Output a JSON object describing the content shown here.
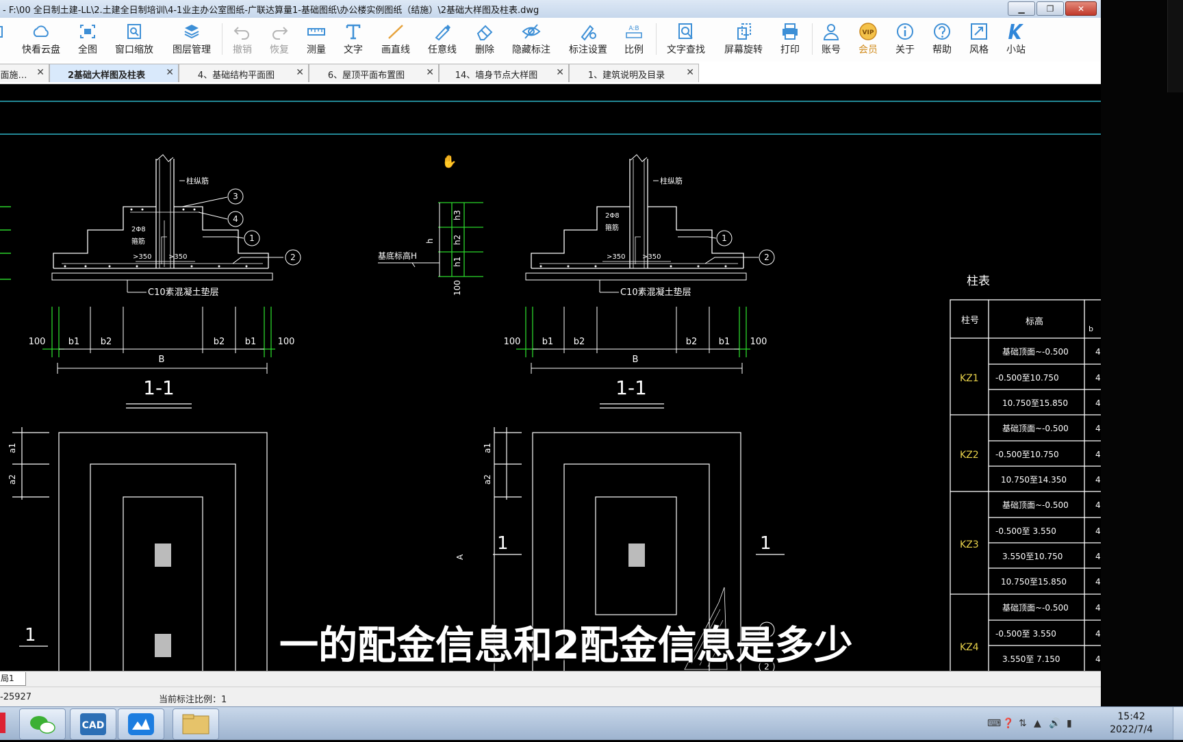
{
  "window": {
    "title": "- F:\\00 全日制土建-LL\\2.土建全日制培训\\4-1业主办公室图纸-广联达算量1-基础图纸\\办公楼实例图纸（结施）\\2基础大样图及柱表.dwg",
    "minimize": "▁",
    "restore": "❐",
    "close": "✕"
  },
  "toolbar": {
    "tools": [
      {
        "label": "开",
        "icon": "open-icon"
      },
      {
        "label": "快看云盘",
        "icon": "cloud-icon"
      },
      {
        "label": "全图",
        "icon": "fit-all-icon"
      },
      {
        "label": "窗口缩放",
        "icon": "window-zoom-icon"
      },
      {
        "label": "图层管理",
        "icon": "layers-icon"
      },
      {
        "label": "撤销",
        "icon": "undo-icon"
      },
      {
        "label": "恢复",
        "icon": "redo-icon"
      },
      {
        "label": "测量",
        "icon": "measure-icon"
      },
      {
        "label": "文字",
        "icon": "text-icon"
      },
      {
        "label": "画直线",
        "icon": "line-icon"
      },
      {
        "label": "任意线",
        "icon": "freehand-icon"
      },
      {
        "label": "删除",
        "icon": "eraser-icon"
      },
      {
        "label": "隐藏标注",
        "icon": "hide-annotation-icon"
      },
      {
        "label": "标注设置",
        "icon": "annotation-settings-icon"
      },
      {
        "label": "比例",
        "icon": "scale-icon"
      },
      {
        "label": "文字查找",
        "icon": "text-search-icon"
      },
      {
        "label": "屏幕旋转",
        "icon": "rotate-screen-icon"
      },
      {
        "label": "打印",
        "icon": "print-icon"
      },
      {
        "label": "账号",
        "icon": "account-icon"
      },
      {
        "label": "会员",
        "icon": "vip-icon"
      },
      {
        "label": "关于",
        "icon": "info-icon"
      },
      {
        "label": "帮助",
        "icon": "help-icon"
      },
      {
        "label": "风格",
        "icon": "style-icon"
      },
      {
        "label": "小站",
        "icon": "k-site-icon"
      }
    ],
    "vip_badge": "VIP",
    "scale_badge": "A:B"
  },
  "tabs": [
    {
      "label": "面施…",
      "close": "✕"
    },
    {
      "label": "2基础大样图及柱表",
      "close": "✕",
      "active": true
    },
    {
      "label": "4、基础结构平面图",
      "close": "✕"
    },
    {
      "label": "6、屋顶平面布置图",
      "close": "✕"
    },
    {
      "label": "14、墙身节点大样图",
      "close": "✕"
    },
    {
      "label": "1、建筑说明及目录",
      "close": "✕"
    }
  ],
  "drawing": {
    "left_detail": {
      "rebar_label": "柱纵筋",
      "stirrup_label": "2Φ8\n箍筋",
      "dim_350": ">350",
      "pad_note": "C10素混凝土垫层",
      "bubbles": [
        "3",
        "4",
        "1",
        "2"
      ],
      "dims": [
        "100",
        "b1",
        "b2",
        "b2",
        "b1",
        "100"
      ],
      "width": "B",
      "section": "1-1"
    },
    "right_detail": {
      "rebar_label": "柱纵筋",
      "stirrup_label": "2Φ8\n箍筋",
      "dim_350": ">350",
      "pad_note": "C10素混凝土垫层",
      "bubbles": [
        "1",
        "2"
      ],
      "dims": [
        "100",
        "b1",
        "b2",
        "b2",
        "b1",
        "100"
      ],
      "width": "B",
      "section": "1-1"
    },
    "step_detail": {
      "label": "基底标高H",
      "h": "h",
      "h1": "h1",
      "h2": "h2",
      "h3": "h3",
      "base": "100"
    },
    "plan_labels": {
      "a1": "a1",
      "a2": "a2",
      "section_mark": "1",
      "A": "A"
    },
    "column_table": {
      "title": "柱表",
      "headers": [
        "柱号",
        "标高",
        "b"
      ],
      "groups": [
        {
          "id": "KZ1",
          "rows": [
            "基础顶面~-0.500",
            "-0.500至10.750",
            "10.750至15.850"
          ]
        },
        {
          "id": "KZ2",
          "rows": [
            "基础顶面~-0.500",
            "-0.500至10.750",
            "10.750至14.350"
          ]
        },
        {
          "id": "KZ3",
          "rows": [
            "基础顶面~-0.500",
            "-0.500至 3.550",
            "3.550至10.750",
            "10.750至15.850"
          ]
        },
        {
          "id": "KZ4",
          "rows": [
            "基础顶面~-0.500",
            "-0.500至 3.550",
            "3.550至 7.150"
          ]
        }
      ],
      "cut_value": "4"
    }
  },
  "subtitle": "一的配金信息和2配金信息是多少",
  "layout_tab": "局1",
  "status": {
    "coords": "-25927",
    "scale": "当前标注比例：1"
  },
  "taskbar": {
    "apps": [
      "wechat-icon",
      "cad-icon",
      "cloud-app-icon",
      "file-explorer-icon"
    ],
    "cad_text": "CAD",
    "time": "15:42",
    "date": "2022/7/4"
  }
}
